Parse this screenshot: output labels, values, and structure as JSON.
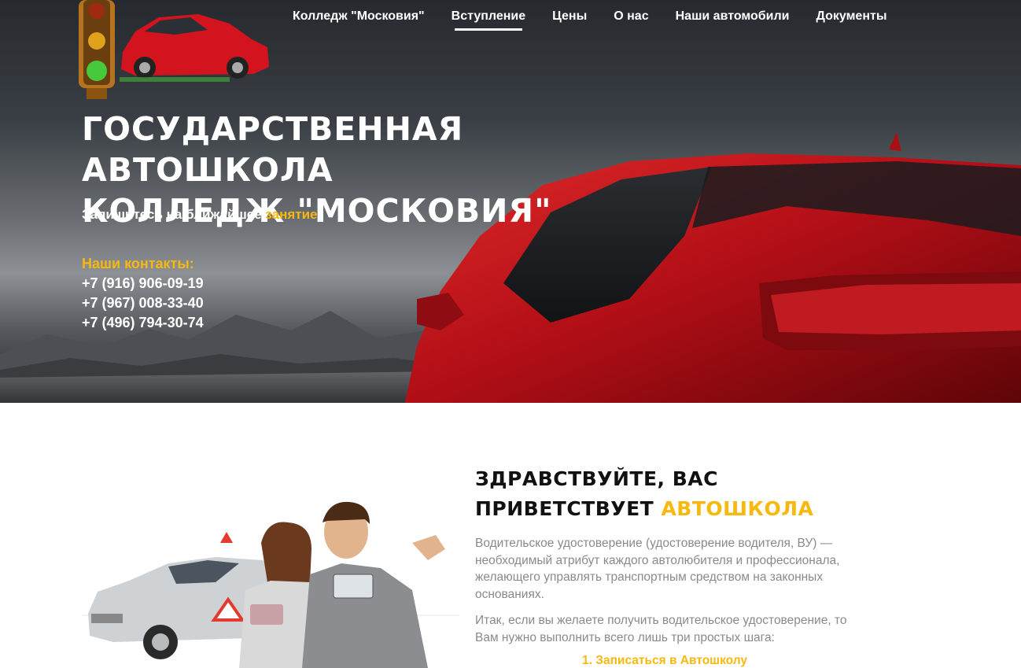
{
  "nav": {
    "items": [
      {
        "label": "Колледж \"Московия\""
      },
      {
        "label": "Вступление",
        "active": true
      },
      {
        "label": "Цены"
      },
      {
        "label": "О нас"
      },
      {
        "label": "Наши автомобили"
      },
      {
        "label": "Документы"
      }
    ]
  },
  "hero": {
    "title_line1": "Государственная автошкола",
    "title_line2": "Колледж \"Московия\"",
    "subtitle_prefix": "Запишитесь на ближайшее",
    "subtitle_highlight": "занятие",
    "contacts_label": "Наши контакты:",
    "phones": [
      "+7 (916) 906-09-19",
      "+7 (967) 008-33-40",
      "+7 (496) 794-30-74"
    ]
  },
  "welcome": {
    "title_line1": "Здравствуйте, вас",
    "title_line2_prefix": "приветствует",
    "title_line2_highlight": "Автошкола",
    "paragraph1": "Водительское удостоверение (удостоверение водителя, ВУ) — необходимый атрибут каждого автолюбителя и профессионала, желающего управлять транспортным средством на законных основаниях.",
    "paragraph2": "Итак, если вы желаете получить водительское удостоверение, то Вам нужно выполнить всего лишь три простых шага:",
    "step1": "1. Записаться в Автошколу"
  },
  "colors": {
    "accent": "#f7b90f",
    "car_red": "#c0141c",
    "text_gray": "#8a8a8a"
  }
}
